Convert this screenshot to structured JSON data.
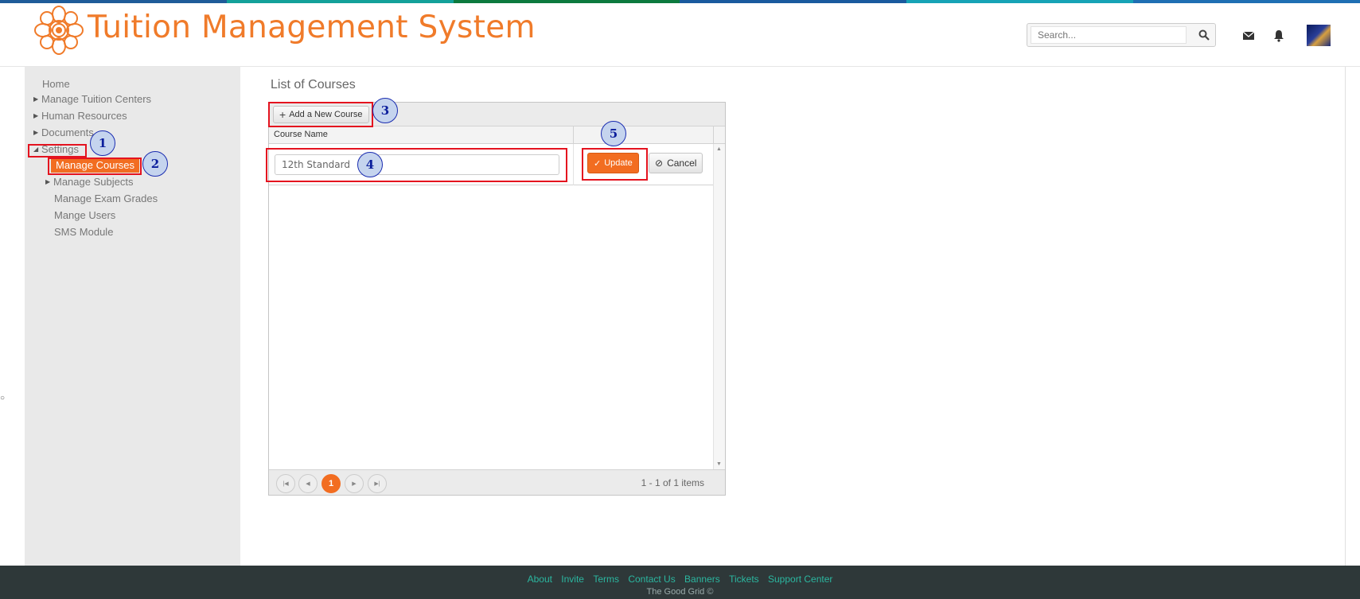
{
  "header": {
    "app_title": "Tuition Management System",
    "search_placeholder": "Search...",
    "icons": [
      "logo-icon",
      "search-icon",
      "mail-icon",
      "bell-icon",
      "avatar"
    ],
    "accent_color": "#f07b2a"
  },
  "sidebar": {
    "items": [
      {
        "label": "Home"
      },
      {
        "label": "Manage Tuition Centers"
      },
      {
        "label": "Human Resources"
      },
      {
        "label": "Documents"
      },
      {
        "label": "Settings"
      }
    ],
    "settings_children": [
      {
        "label": "Manage Courses",
        "active": true
      },
      {
        "label": "Manage Subjects"
      },
      {
        "label": "Manage Exam Grades"
      },
      {
        "label": "Mange Users"
      },
      {
        "label": "SMS Module"
      }
    ]
  },
  "main": {
    "title": "List of Courses",
    "toolbar": {
      "add_label": "Add a New Course"
    },
    "columns": [
      "Course Name"
    ],
    "edit_row": {
      "course_name_value": "12th Standard",
      "update_label": "Update",
      "cancel_label": "Cancel"
    },
    "pager": {
      "current_page": "1",
      "info": "1 - 1 of 1 items"
    }
  },
  "callouts": [
    "1",
    "2",
    "3",
    "4",
    "5"
  ],
  "footer": {
    "links": [
      "About",
      "Invite",
      "Terms",
      "Contact Us",
      "Banners",
      "Tickets",
      "Support Center"
    ],
    "copyright": "The Good Grid ©"
  },
  "colors": {
    "active_orange": "#f26d21",
    "annotation_red": "#e4131f",
    "footer_bg": "#2e3839",
    "footer_link": "#2bb7a0"
  }
}
